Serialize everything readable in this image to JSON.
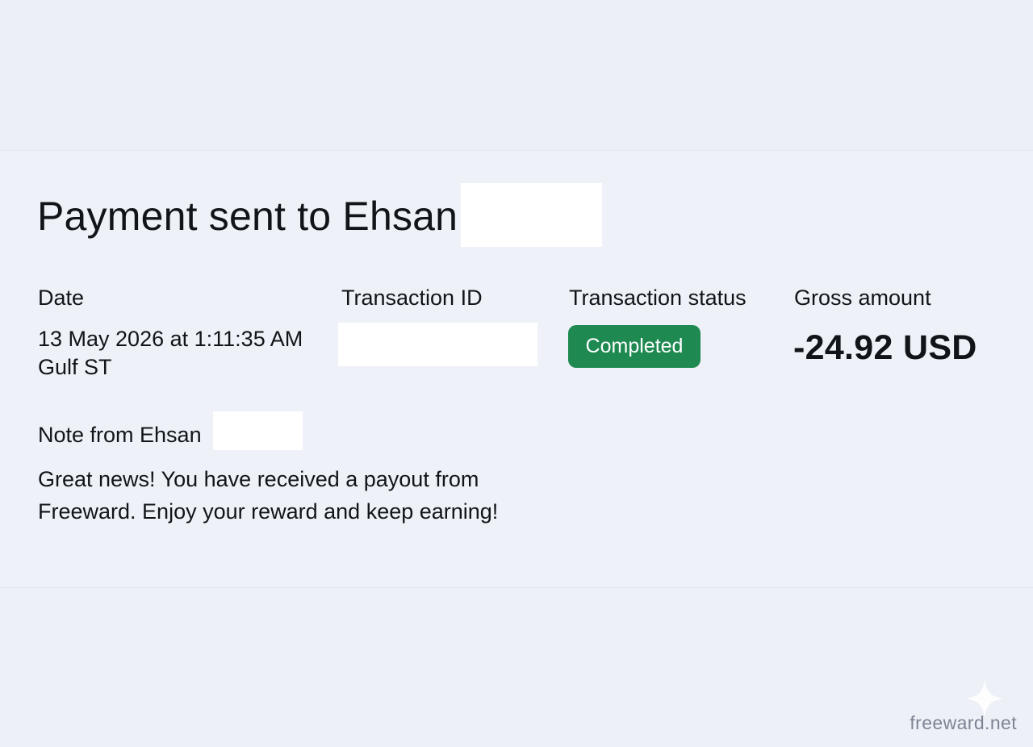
{
  "payment": {
    "title": "Payment sent to Ehsan",
    "date_label": "Date",
    "date_line1": "13 May 2026 at 1:11:35 AM",
    "date_line2": "Gulf ST",
    "transaction_id_label": "Transaction ID",
    "transaction_status_label": "Transaction status",
    "status_value": "Completed",
    "gross_amount_label": "Gross amount",
    "gross_amount_value": "-24.92 USD",
    "note_label": "Note from Ehsan",
    "note_line1": "Great news! You have received a payout from",
    "note_line2": "Freeward. Enjoy your reward and keep earning!"
  },
  "watermark": {
    "text": "freeward.net",
    "icon": "sparkle-icon"
  },
  "colors": {
    "background": "#edf0f7",
    "status_badge": "#1e8a52",
    "redaction": "#ffffff"
  }
}
